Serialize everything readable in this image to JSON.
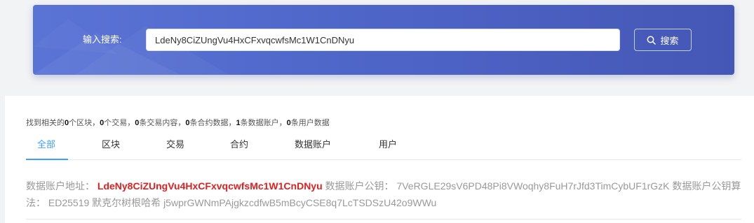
{
  "search": {
    "label": "输入搜索:",
    "query": "LdeNy8CiZUngVu4HxCFxvqcwfsMc1W1CnDNyu",
    "button_label": "搜索",
    "button_icon": "search-icon"
  },
  "summary": {
    "prefix": "找到相关的",
    "blocks_count": "0",
    "blocks_label": "个区块，",
    "tx_count": "0",
    "tx_label": "个交易，",
    "txcontent_count": "0",
    "txcontent_label": "条交易内容，",
    "contract_count": "0",
    "contract_label": "条合约数据，",
    "dataaccount_count": "1",
    "dataaccount_label": "条数据账户，",
    "user_count": "0",
    "user_label": "条用户数据"
  },
  "tabs": {
    "all": "全部",
    "block": "区块",
    "transaction": "交易",
    "contract": "合约",
    "data_account": "数据账户",
    "user": "用户",
    "active_color": "#409eff"
  },
  "result": {
    "address_label": "数据账户地址：",
    "address_value": "LdeNy8CiZUngVu4HxCFxvqcwfsMc1W1CnDNyu",
    "pubkey_label": "数据账户公钥：",
    "pubkey_value": "7VeRGLE29sV6PD48Pi8VWoqhy8FuH7rJfd3TimCybUF1rGzK",
    "algorithm_label": "数据账户公钥算法：",
    "algorithm_value": "ED25519",
    "signature_label": "默克尔树根哈希",
    "signature_value": "j5wprGWNmPAjgkzcdfwB5mBcyCSE8q7LcTSDSzU42o9WWu",
    "highlight_color": "#e02020"
  }
}
